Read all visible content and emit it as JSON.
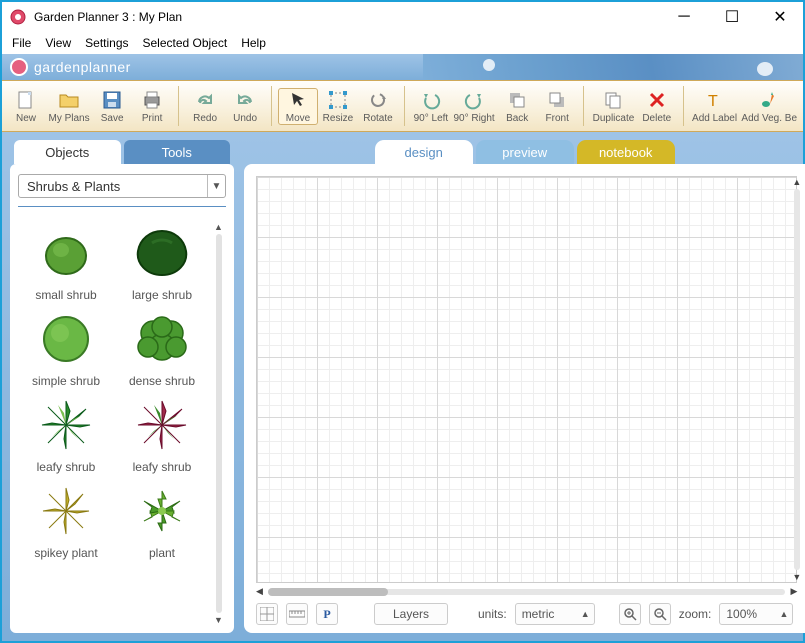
{
  "window": {
    "title": "Garden Planner 3 : My  Plan"
  },
  "menubar": [
    "File",
    "View",
    "Settings",
    "Selected Object",
    "Help"
  ],
  "brand": {
    "name": "garden",
    "suffix": "planner"
  },
  "toolbar": {
    "groups": [
      [
        "New",
        "My Plans",
        "Save",
        "Print"
      ],
      [
        "Redo",
        "Undo"
      ],
      [
        "Move",
        "Resize",
        "Rotate"
      ],
      [
        "90° Left",
        "90° Right",
        "Back",
        "Front"
      ],
      [
        "Duplicate",
        "Delete"
      ],
      [
        "Add Label",
        "Add Veg. Be"
      ]
    ]
  },
  "left": {
    "tabs": {
      "objects": "Objects",
      "tools": "Tools"
    },
    "category": "Shrubs & Plants",
    "items": [
      {
        "name": "small shrub",
        "style": "smallshrub"
      },
      {
        "name": "large shrub",
        "style": "largeshrub"
      },
      {
        "name": "simple shrub",
        "style": "simpleshrub"
      },
      {
        "name": "dense shrub",
        "style": "denseshrub"
      },
      {
        "name": "leafy shrub",
        "style": "leafy1"
      },
      {
        "name": "leafy shrub",
        "style": "leafy2"
      },
      {
        "name": "spikey plant",
        "style": "spikey"
      },
      {
        "name": "plant",
        "style": "plant"
      }
    ]
  },
  "canvas_tabs": {
    "design": "design",
    "preview": "preview",
    "notebook": "notebook"
  },
  "status": {
    "layers": "Layers",
    "units_label": "units:",
    "units_value": "metric",
    "zoom_label": "zoom:",
    "zoom_value": "100%",
    "P": "P"
  },
  "colors": {
    "accent": "#5a8fc3",
    "tab_preview": "#8fbfe3",
    "tab_notebook": "#d4b827"
  }
}
